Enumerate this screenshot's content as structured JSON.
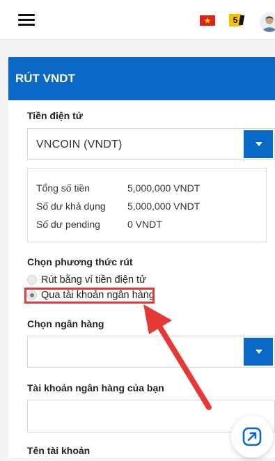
{
  "header": {
    "notification_count": "5"
  },
  "card": {
    "title": "RÚT VNDT",
    "crypto_label": "Tiền điện tử",
    "crypto_selected": "VNCOIN (VNDT)",
    "info": [
      {
        "label": "Tổng số tiền",
        "value": "5,000,000 VNDT"
      },
      {
        "label": "Số dư khả dụng",
        "value": "5,000,000 VNDT"
      },
      {
        "label": "Số dư pending",
        "value": "0 VNDT"
      }
    ],
    "method_label": "Chọn phương thức rút",
    "methods": [
      {
        "label": "Rút bằng ví tiền điện tử",
        "checked": false
      },
      {
        "label": "Qua tài khoản ngân hàng",
        "checked": true
      }
    ],
    "bank_label": "Chọn ngân hàng",
    "bank_selected": "",
    "account_label": "Tài khoản ngân hàng của bạn",
    "account_value": "",
    "account_name_label": "Tên tài khoản"
  },
  "colors": {
    "primary": "#0a68c6",
    "annotation": "#e53935"
  },
  "icons": {
    "menu": "hamburger-icon",
    "flag": "vietnam-flag-icon",
    "avatar": "user-avatar-icon",
    "fab": "arrow-up-right-icon"
  }
}
